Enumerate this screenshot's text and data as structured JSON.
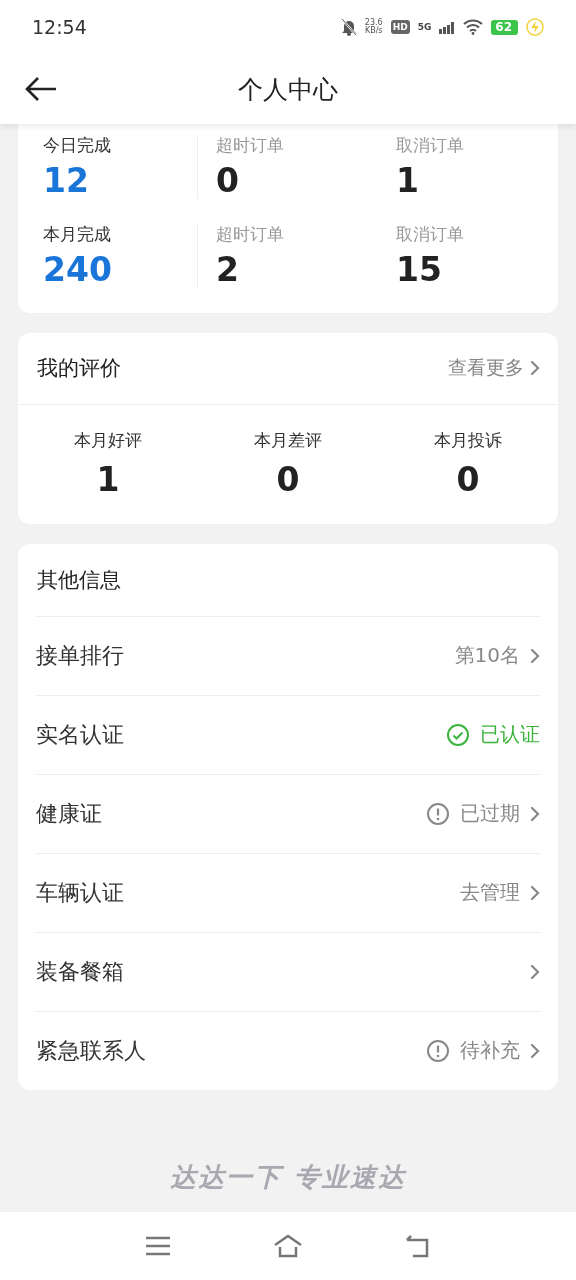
{
  "status_bar": {
    "time": "12:54",
    "speed_value": "23.6",
    "speed_unit": "KB/s",
    "hd": "HD",
    "network": "5G",
    "battery": "62"
  },
  "header": {
    "title": "个人中心"
  },
  "stats": [
    {
      "label": "今日完成",
      "value": "12",
      "items": [
        {
          "label": "超时订单",
          "value": "0"
        },
        {
          "label": "取消订单",
          "value": "1"
        }
      ]
    },
    {
      "label": "本月完成",
      "value": "240",
      "items": [
        {
          "label": "超时订单",
          "value": "2"
        },
        {
          "label": "取消订单",
          "value": "15"
        }
      ]
    }
  ],
  "reviews": {
    "title": "我的评价",
    "more": "查看更多",
    "items": [
      {
        "label": "本月好评",
        "value": "1"
      },
      {
        "label": "本月差评",
        "value": "0"
      },
      {
        "label": "本月投诉",
        "value": "0"
      }
    ]
  },
  "other": {
    "title": "其他信息",
    "rows": [
      {
        "label": "接单排行",
        "value": "第10名",
        "kind": "plain",
        "chevron": true
      },
      {
        "label": "实名认证",
        "value": "已认证",
        "kind": "verified",
        "chevron": false
      },
      {
        "label": "健康证",
        "value": "已过期",
        "kind": "warning",
        "chevron": true
      },
      {
        "label": "车辆认证",
        "value": "去管理",
        "kind": "plain",
        "chevron": true
      },
      {
        "label": "装备餐箱",
        "chevron": true
      },
      {
        "label": "紧急联系人",
        "value": "待补充",
        "kind": "warning",
        "chevron": true
      }
    ]
  },
  "slogan": "达达一下 专业速达"
}
